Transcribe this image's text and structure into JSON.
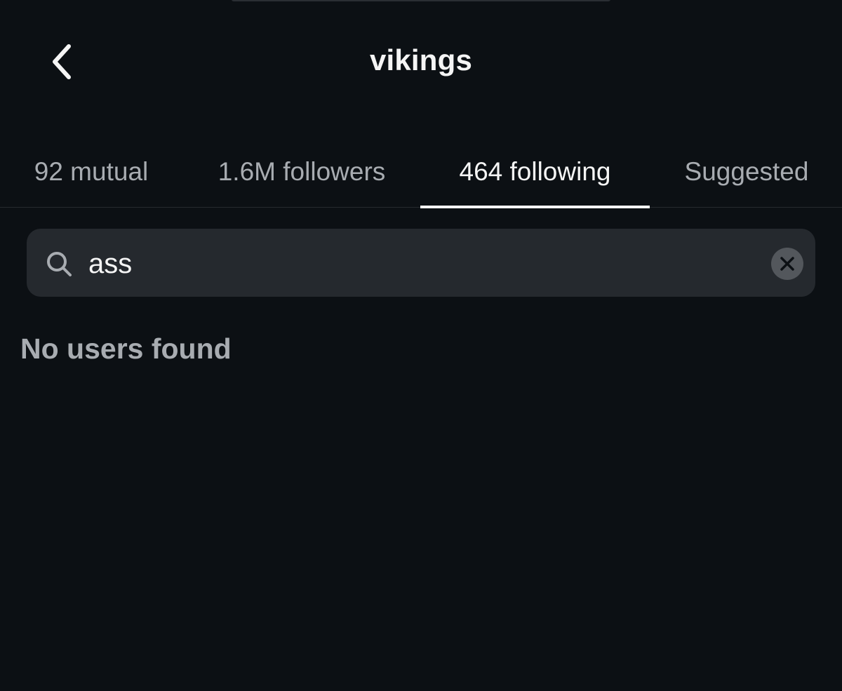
{
  "header": {
    "title": "vikings",
    "back_icon": "chevron-left-icon"
  },
  "tabs": [
    {
      "label": "92 mutual",
      "active": false
    },
    {
      "label": "1.6M followers",
      "active": false
    },
    {
      "label": "464 following",
      "active": true
    },
    {
      "label": "Suggested",
      "active": false
    }
  ],
  "search": {
    "value": "ass",
    "icon": "search-icon",
    "clear_icon": "clear-icon"
  },
  "results": {
    "empty_message": "No users found"
  },
  "colors": {
    "background": "#0c1014",
    "text_primary": "#f5f5f5",
    "text_secondary": "#a8acb1",
    "search_bg": "#25292e",
    "divider": "#262a2f"
  }
}
